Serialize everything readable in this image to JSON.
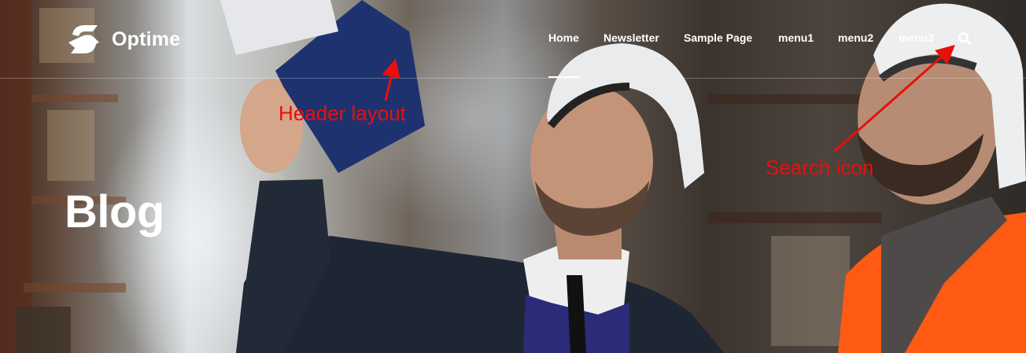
{
  "brand": {
    "name": "Optime"
  },
  "nav": {
    "items": [
      {
        "label": "Home",
        "active": true
      },
      {
        "label": "Newsletter",
        "active": false
      },
      {
        "label": "Sample Page",
        "active": false
      },
      {
        "label": "menu1",
        "active": false
      },
      {
        "label": "menu2",
        "active": false
      },
      {
        "label": "menu3",
        "active": false
      }
    ],
    "search_icon": "search-icon"
  },
  "hero": {
    "title": "Blog"
  },
  "annotations": {
    "header_layout": "Header layout",
    "search_icon": "Search icon",
    "color": "#e8100c"
  }
}
